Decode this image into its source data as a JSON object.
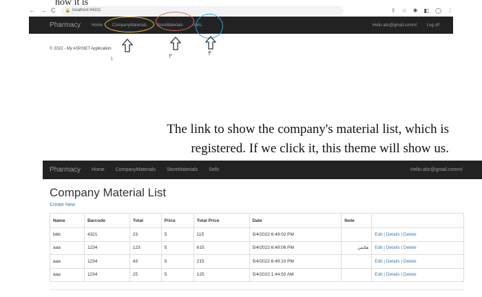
{
  "clipped_top_text": "how it is",
  "browser": {
    "url": "localhost:44311",
    "back": "←",
    "forward": "→",
    "reload": "C",
    "lock": "🔒",
    "icons": [
      "⇪",
      "☆",
      "✱",
      "◧",
      "◯",
      "⋮"
    ]
  },
  "screen1": {
    "brand": "Pharmacy",
    "nav": [
      "Home",
      "CompanyMaterials",
      "StoreMaterials",
      "Sells"
    ],
    "greeting": "Hello abc@gmail.comm!",
    "logoff": "Log off",
    "footer": "© 2022 - My ASP.NET Application",
    "markers": [
      "١",
      "٢",
      "٣"
    ],
    "colors": {
      "marker1": "#2a8fd6",
      "marker2": "#b03a2e",
      "marker3": "#555555"
    }
  },
  "caption": {
    "line1": "The link to show the company's material list, which is",
    "line2": "registered. If we click it, this theme will show us."
  },
  "screen2": {
    "brand": "Pharmacy",
    "nav": [
      "Home",
      "CompanyMaterials",
      "StoreMaterials",
      "Sells"
    ],
    "greeting": "Hello abc@gmail.comm!",
    "page_title": "Company Material List",
    "create_new": "Create New",
    "table": {
      "headers": [
        "Name",
        "Barcode",
        "Total",
        "Price",
        "Total Price",
        "Date",
        "Note",
        ""
      ],
      "rows": [
        [
          "bbb",
          "4321",
          "23",
          "5",
          "115",
          "5/4/2022 6:49:02 PM",
          "",
          "Edit | Details | Delete"
        ],
        [
          "aaa",
          "1234",
          "123",
          "5",
          "615",
          "5/4/2022 6:49:06 PM",
          "هكتس",
          "Edit | Details | Delete"
        ],
        [
          "aaa",
          "1234",
          "43",
          "5",
          "215",
          "5/4/2022 6:49:10 PM",
          "",
          "Edit | Details | Delete"
        ],
        [
          "aaa",
          "1234",
          "25",
          "5",
          "125",
          "5/4/2022 1:44:50 AM",
          "",
          "Edit | Details | Delete"
        ]
      ]
    }
  }
}
